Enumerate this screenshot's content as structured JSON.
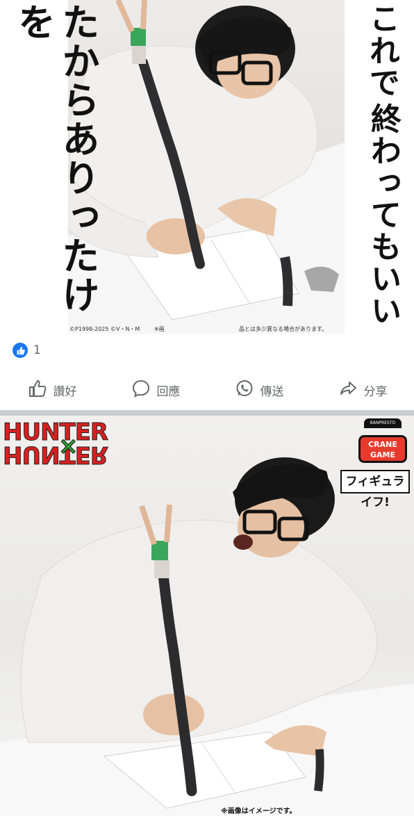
{
  "post": {
    "vertical_text_left": "たからありったけを",
    "vertical_text_right_1": "これで",
    "vertical_text_right_2": "終わってもいい",
    "copyright": "©P1998-2025 ©V・N・M",
    "copyright_mark": "※画",
    "disclaimer": "品とは多少異なる場合があります。"
  },
  "reactions": {
    "icon": "like-icon",
    "count": "1"
  },
  "actions": [
    {
      "icon": "thumbs-up-icon",
      "label": "讚好"
    },
    {
      "icon": "comment-icon",
      "label": "回應"
    },
    {
      "icon": "whatsapp-icon",
      "label": "傳送"
    },
    {
      "icon": "share-icon",
      "label": "分享"
    }
  ],
  "second_image": {
    "brand_logo": "HUNTER×HUNTER",
    "brand_logo_top": "HUNTER",
    "brand_logo_bottom": "HUNTER",
    "crane_maker": "BANPRESTO",
    "crane_label": "CRANE GAME",
    "figure_label": "フィギュライフ!",
    "image_note": "※画像はイメージです。"
  },
  "colors": {
    "accent": "#1877f2",
    "action_text": "#65676b",
    "divider": "#c9ccd1",
    "logo_red": "#d8201f",
    "logo_green": "#2f9a36"
  }
}
